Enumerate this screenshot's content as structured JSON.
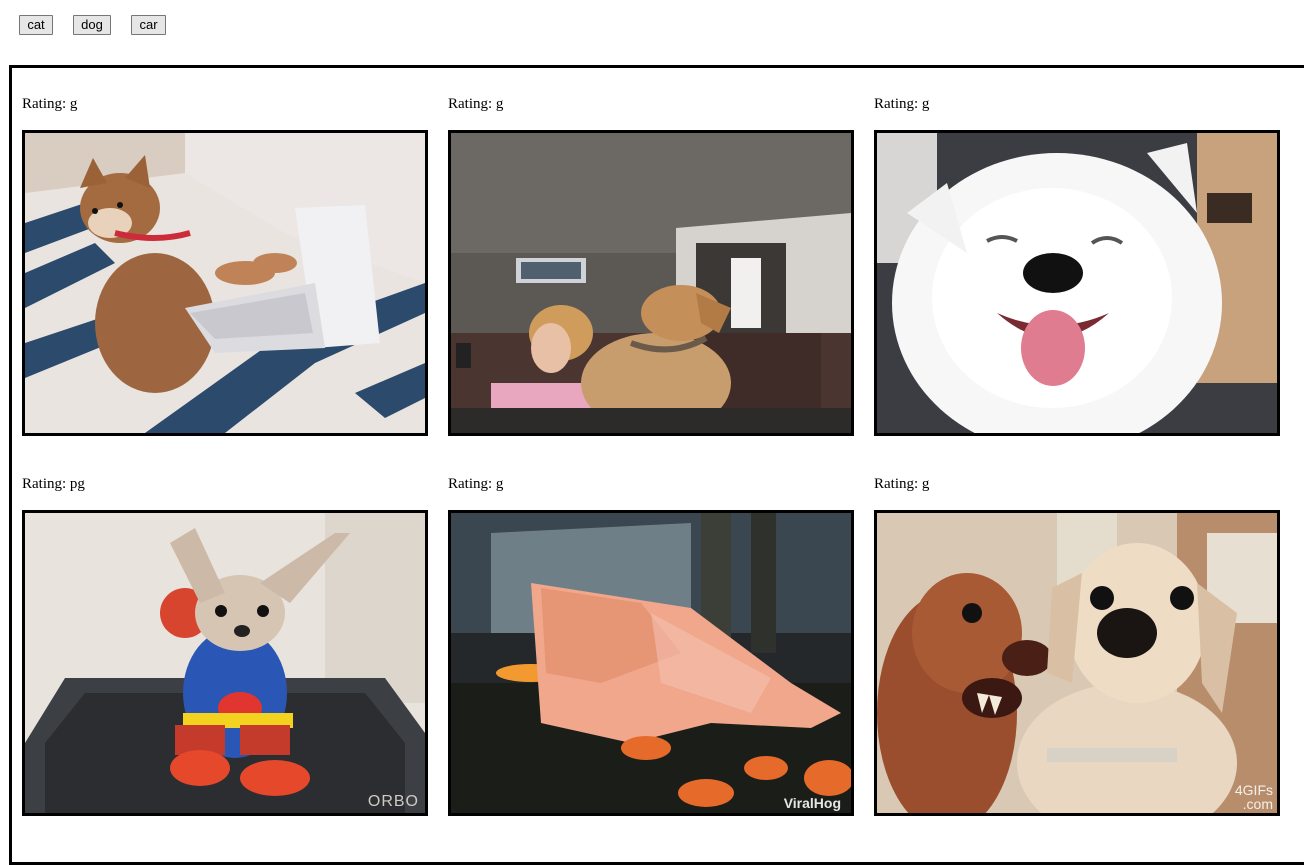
{
  "topics": [
    {
      "label": "cat"
    },
    {
      "label": "dog"
    },
    {
      "label": "car"
    }
  ],
  "gifs": [
    {
      "rating_label": "Rating: g",
      "subject": "shiba dog typing on laptop",
      "watermark": ""
    },
    {
      "rating_label": "Rating: g",
      "subject": "dog on couch next to woman",
      "watermark": ""
    },
    {
      "rating_label": "Rating: g",
      "subject": "smiling white samoyed",
      "watermark": ""
    },
    {
      "rating_label": "Rating: pg",
      "subject": "chihuahua in superman costume on treadmill",
      "watermark": "ORBO"
    },
    {
      "rating_label": "Rating: g",
      "subject": "dog in ghost costume with pumpkins",
      "watermark": "ViralHog"
    },
    {
      "rating_label": "Rating: g",
      "subject": "two funny-faced dogs",
      "watermark": "4GIFs .com"
    }
  ]
}
